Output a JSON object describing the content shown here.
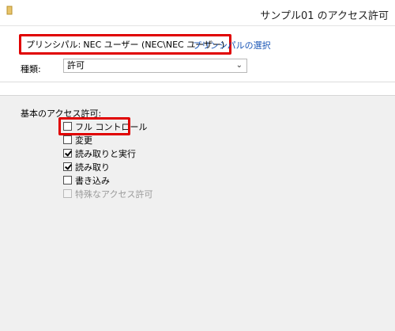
{
  "window": {
    "title": "サンプル01 のアクセス許可"
  },
  "principal": {
    "label": "プリンシパル:",
    "value": "NEC ユーザー (NEC\\NEC ユーザー)",
    "select_link": "プリンシパルの選択"
  },
  "type": {
    "label": "種類:",
    "value": "許可"
  },
  "permissions": {
    "heading": "基本のアクセス許可:",
    "items": [
      {
        "label": "フル コントロール",
        "checked": false,
        "disabled": false
      },
      {
        "label": "変更",
        "checked": false,
        "disabled": false
      },
      {
        "label": "読み取りと実行",
        "checked": true,
        "disabled": false
      },
      {
        "label": "読み取り",
        "checked": true,
        "disabled": false
      },
      {
        "label": "書き込み",
        "checked": false,
        "disabled": false
      },
      {
        "label": "特殊なアクセス許可",
        "checked": false,
        "disabled": true
      }
    ]
  },
  "colors": {
    "highlight": "#e00000",
    "link": "#1a56b6",
    "panel": "#f0f0f0"
  },
  "icons": {
    "window": "folder-icon",
    "dropdown": "chevron-down-icon"
  }
}
